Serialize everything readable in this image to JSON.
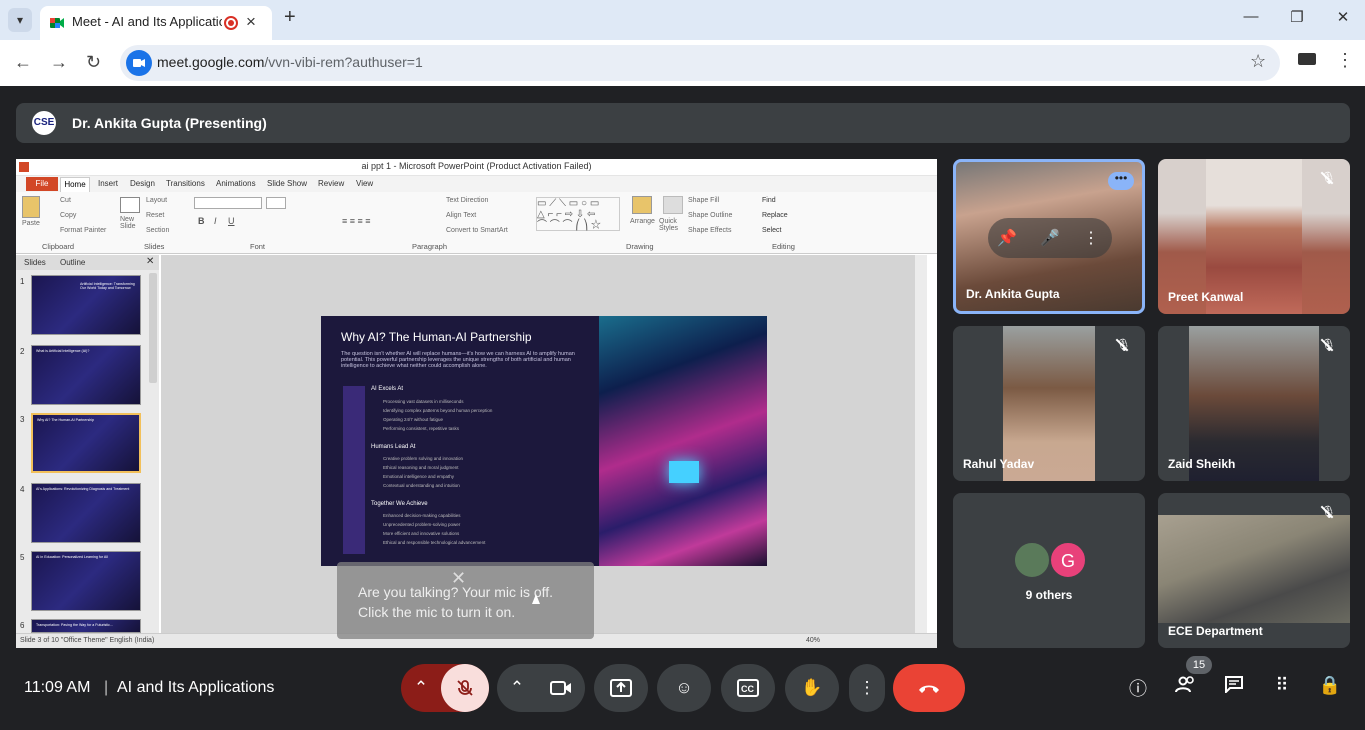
{
  "browser": {
    "tab_title": "Meet - AI and Its Applicatio",
    "new_tab": "+",
    "url_host": "meet.google.com",
    "url_path": "/vvn-vibi-rem?authuser=1",
    "window": {
      "minimize": "—",
      "restore": "❐",
      "close": "✕"
    }
  },
  "presenter": {
    "logo_text": "CSE",
    "name": "Dr. Ankita Gupta (Presenting)"
  },
  "ppt": {
    "window_title": "ai ppt 1 - Microsoft PowerPoint (Product Activation Failed)",
    "tabs": [
      "File",
      "Home",
      "Insert",
      "Design",
      "Transitions",
      "Animations",
      "Slide Show",
      "Review",
      "View"
    ],
    "groups": [
      "Clipboard",
      "Slides",
      "Font",
      "Paragraph",
      "Drawing",
      "Editing"
    ],
    "ribbon": {
      "paste": "Paste",
      "cut": "Cut",
      "copy": "Copy",
      "format_painter": "Format Painter",
      "new_slide": "New Slide",
      "layout": "Layout",
      "reset": "Reset",
      "section": "Section",
      "text_direction": "Text Direction",
      "align_text": "Align Text",
      "convert_smartart": "Convert to SmartArt",
      "arrange": "Arrange",
      "quick_styles": "Quick Styles",
      "shape_fill": "Shape Fill",
      "shape_outline": "Shape Outline",
      "shape_effects": "Shape Effects",
      "find": "Find",
      "replace": "Replace",
      "select": "Select"
    },
    "pane_tabs": [
      "Slides",
      "Outline"
    ],
    "thumbnails": [
      {
        "num": "1",
        "caption": "Artificial Intelligence: Transforming Our World Today and Tomorrow"
      },
      {
        "num": "2",
        "caption": "What is Artificial Intelligence (AI)?"
      },
      {
        "num": "3",
        "caption": "Why AI? The Human-AI Partnership"
      },
      {
        "num": "4",
        "caption": "AI's Applications: Revolutionizing Diagnosis and Treatment"
      },
      {
        "num": "5",
        "caption": "AI in Education: Personalized Learning for All"
      },
      {
        "num": "6",
        "caption": "Transportation: Paving the Way for a Futuristic..."
      }
    ],
    "slide": {
      "title": "Why AI? The Human-AI Partnership",
      "intro": "The question isn't whether AI will replace humans—it's how we can harness AI to amplify human potential. This powerful partnership leverages the unique strengths of both artificial and human intelligence to achieve what neither could accomplish alone.",
      "sections": [
        {
          "heading": "AI Excels At",
          "items": [
            "Processing vast datasets in milliseconds",
            "Identifying complex patterns beyond human perception",
            "Operating 24/7 without fatigue",
            "Performing consistent, repetitive tasks"
          ]
        },
        {
          "heading": "Humans Lead At",
          "items": [
            "Creative problem solving and innovation",
            "Ethical reasoning and moral judgment",
            "Emotional intelligence and empathy",
            "Contextual understanding and intuition"
          ]
        },
        {
          "heading": "Together We Achieve",
          "items": [
            "Enhanced decision-making capabilities",
            "Unprecedented problem-solving power",
            "More efficient and innovative solutions",
            "Ethical and responsible technological advancement"
          ]
        }
      ]
    },
    "status_left": "Slide 3 of 10   \"Office Theme\"   English (India)",
    "zoom": "40%"
  },
  "tooltip": {
    "text": "Are you talking? Your mic is off. Click the mic to turn it on.",
    "close": "✕"
  },
  "participants": {
    "ankita": "Dr. Ankita Gupta",
    "preet": "Preet Kanwal",
    "rahul": "Rahul Yadav",
    "zaid": "Zaid Sheikh",
    "others_initial": "G",
    "others_label": "9 others",
    "ece": "ECE Department"
  },
  "controls": {
    "time": "11:09 AM",
    "separator": "|",
    "meeting_title": "AI and Its Applications",
    "people_count": "15"
  },
  "colors": {
    "hangup": "#ea4335",
    "mic_off_bg": "#f9dedc",
    "active_tile_border": "#8ab4f8"
  }
}
